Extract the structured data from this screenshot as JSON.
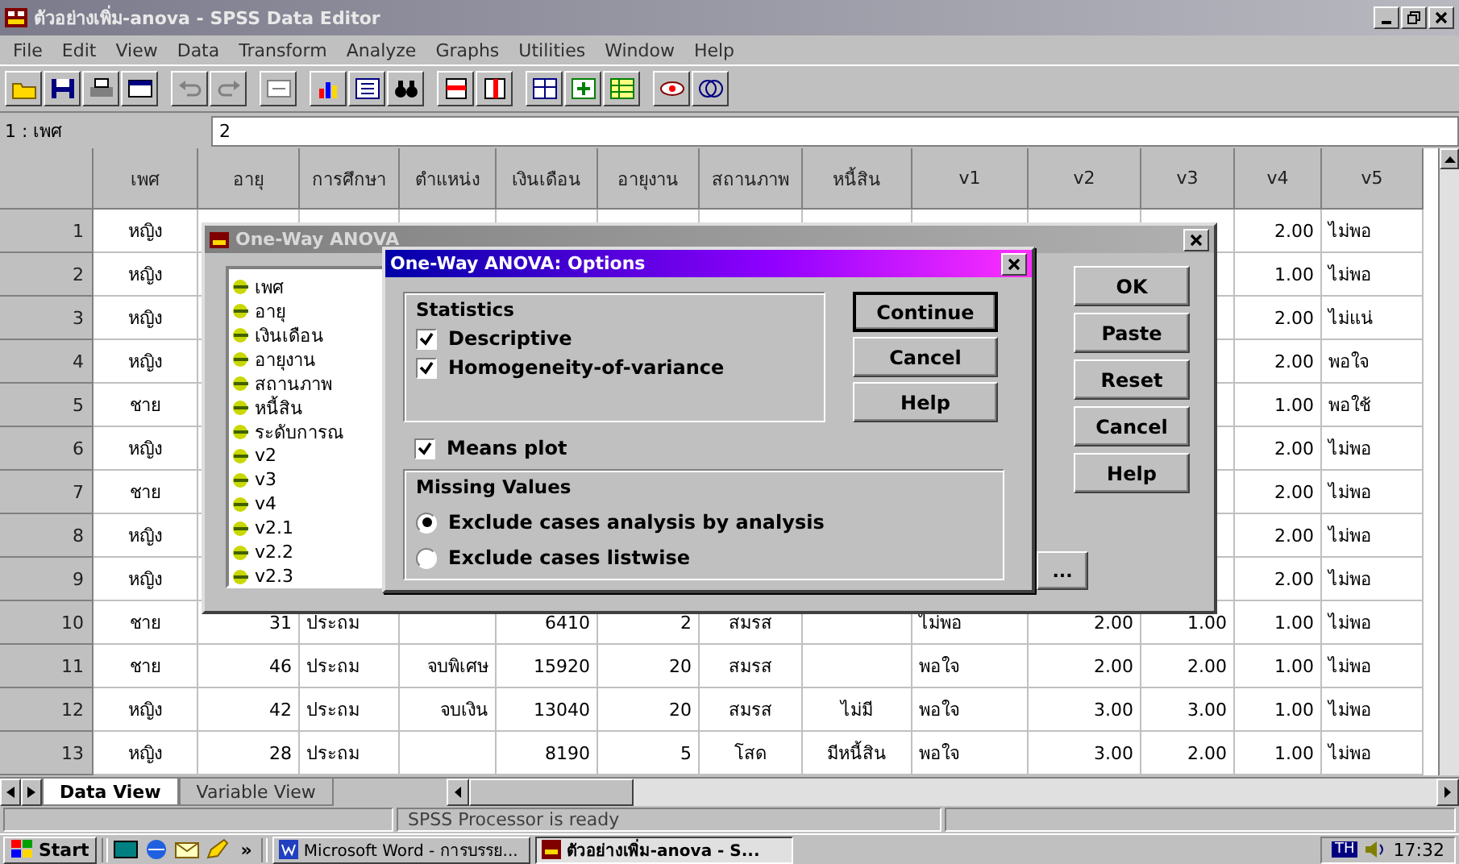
{
  "window": {
    "title": "ตัวอย่างเพิ่ม-anova - SPSS Data Editor"
  },
  "menu": [
    "File",
    "Edit",
    "View",
    "Data",
    "Transform",
    "Analyze",
    "Graphs",
    "Utilities",
    "Window",
    "Help"
  ],
  "cell_editor": {
    "cell": "1 : เพศ",
    "value": "2"
  },
  "table": {
    "columns": [
      "เพศ",
      "อายุ",
      "การศึกษา",
      "ตำแหน่ง",
      "เงินเดือน",
      "อายุงาน",
      "สถานภาพ",
      "หนี้สิน",
      "v1",
      "v2",
      "v3",
      "v4",
      "v5"
    ],
    "rows": [
      {
        "number": "1",
        "cells": [
          "หญิง",
          null,
          null,
          null,
          null,
          null,
          null,
          null,
          null,
          null,
          null,
          "2.00",
          "ไม่พอ"
        ]
      },
      {
        "number": "2",
        "cells": [
          "หญิง",
          null,
          null,
          null,
          null,
          null,
          null,
          null,
          null,
          null,
          null,
          "1.00",
          "ไม่พอ"
        ]
      },
      {
        "number": "3",
        "cells": [
          "หญิง",
          null,
          null,
          null,
          null,
          null,
          null,
          null,
          null,
          null,
          null,
          "2.00",
          "ไม่แน่"
        ]
      },
      {
        "number": "4",
        "cells": [
          "หญิง",
          null,
          null,
          null,
          null,
          null,
          null,
          null,
          null,
          null,
          null,
          "2.00",
          "พอใจ"
        ]
      },
      {
        "number": "5",
        "cells": [
          "ชาย",
          null,
          null,
          null,
          null,
          null,
          null,
          null,
          null,
          null,
          null,
          "1.00",
          "พอใช้"
        ]
      },
      {
        "number": "6",
        "cells": [
          "หญิง",
          null,
          null,
          null,
          null,
          null,
          null,
          null,
          null,
          null,
          null,
          "2.00",
          "ไม่พอ"
        ]
      },
      {
        "number": "7",
        "cells": [
          "ชาย",
          null,
          null,
          null,
          null,
          null,
          null,
          null,
          null,
          null,
          null,
          "2.00",
          "ไม่พอ"
        ]
      },
      {
        "number": "8",
        "cells": [
          "หญิง",
          null,
          null,
          null,
          null,
          null,
          null,
          null,
          null,
          null,
          null,
          "2.00",
          "ไม่พอ"
        ]
      },
      {
        "number": "9",
        "cells": [
          "หญิง",
          null,
          null,
          null,
          null,
          null,
          null,
          null,
          null,
          null,
          null,
          "2.00",
          "ไม่พอ"
        ]
      },
      {
        "number": "10",
        "cells": [
          "ชาย",
          "31",
          "ประถม",
          null,
          "6410",
          "2",
          "สมรส",
          null,
          "ไม่พอ",
          "2.00",
          "1.00",
          "1.00",
          "ไม่พอ"
        ]
      },
      {
        "number": "11",
        "cells": [
          "ชาย",
          "46",
          "ประถม",
          "จบพิเศษ",
          "15920",
          "20",
          "สมรส",
          null,
          "พอใจ",
          "2.00",
          "2.00",
          "1.00",
          "ไม่พอ"
        ]
      },
      {
        "number": "12",
        "cells": [
          "หญิง",
          "42",
          "ประถม",
          "จบเงิน",
          "13040",
          "20",
          "สมรส",
          "ไม่มี",
          "พอใจ",
          "3.00",
          "3.00",
          "1.00",
          "ไม่พอ"
        ]
      },
      {
        "number": "13",
        "cells": [
          "หญิง",
          "28",
          "ประถม",
          null,
          "8190",
          "5",
          "โสด",
          "มีหนี้สิน",
          "พอใจ",
          "3.00",
          "2.00",
          "1.00",
          "ไม่พอ"
        ]
      }
    ]
  },
  "sheet_tabs": [
    {
      "label": "Data View",
      "selected": true
    },
    {
      "label": "Variable View",
      "selected": false
    }
  ],
  "status_bar": "SPSS Processor is ready",
  "dialog": {
    "title": "One-Way ANOVA",
    "variables": [
      "เพศ",
      "อายุ",
      "เงินเดือน",
      "อายุงาน",
      "สถานภาพ",
      "หนี้สิน",
      "ระดับการณ",
      "v2",
      "v3",
      "v4",
      "v2.1",
      "v2.2",
      "v2.3"
    ],
    "buttons": [
      "OK",
      "Paste",
      "Reset",
      "Cancel",
      "Help"
    ],
    "more_button": "..."
  },
  "options_dialog": {
    "title": "One-Way ANOVA: Options",
    "statistics": {
      "title": "Statistics",
      "options": [
        {
          "label": "Descriptive",
          "checked": true
        },
        {
          "label": "Homogeneity-of-variance",
          "checked": true
        }
      ]
    },
    "means_plot": {
      "label": "Means plot",
      "checked": true
    },
    "missing_values": {
      "title": "Missing Values",
      "options": [
        {
          "label": "Exclude cases analysis by analysis",
          "selected": true
        },
        {
          "label": "Exclude cases listwise",
          "selected": false
        }
      ]
    },
    "buttons": [
      "Continue",
      "Cancel",
      "Help"
    ]
  },
  "taskbar": {
    "start": "Start",
    "more": "»",
    "tasks": [
      {
        "label": "Microsoft Word - การบรรย...",
        "selected": false
      },
      {
        "label": "ตัวอย่างเพิ่ม-anova - S...",
        "selected": true
      }
    ],
    "language": "TH",
    "time": "17:32"
  }
}
